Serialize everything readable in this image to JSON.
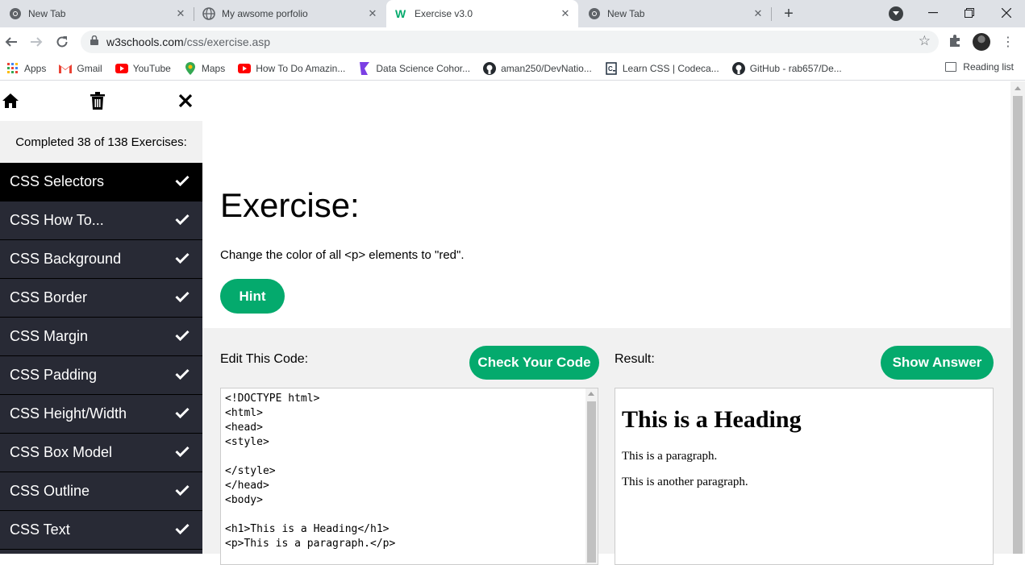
{
  "browser": {
    "tabs": [
      {
        "title": "New Tab",
        "icon": "chrome-icon",
        "active": false
      },
      {
        "title": "My awsome porfolio",
        "icon": "globe-icon",
        "active": false
      },
      {
        "title": "Exercise v3.0",
        "icon": "w3schools-icon",
        "active": true
      },
      {
        "title": "New Tab",
        "icon": "chrome-icon",
        "active": false
      }
    ],
    "close_glyph": "✕",
    "new_tab_glyph": "+",
    "url_domain": "w3schools.com",
    "url_path": "/css/exercise.asp",
    "bookmarks": [
      {
        "label": "Apps",
        "icon": "apps-grid-icon"
      },
      {
        "label": "Gmail",
        "icon": "gmail-icon"
      },
      {
        "label": "YouTube",
        "icon": "youtube-icon"
      },
      {
        "label": "Maps",
        "icon": "maps-icon"
      },
      {
        "label": "How To Do Amazin...",
        "icon": "youtube-icon"
      },
      {
        "label": "Data Science Cohor...",
        "icon": "data-science-icon"
      },
      {
        "label": "aman250/DevNatio...",
        "icon": "github-icon"
      },
      {
        "label": "Learn CSS | Codeca...",
        "icon": "codecademy-icon"
      },
      {
        "label": "GitHub - rab657/De...",
        "icon": "github-icon"
      }
    ],
    "reading_list": "Reading list"
  },
  "sidebar": {
    "completed_text": "Completed 38 of 138 Exercises:",
    "items": [
      {
        "label": "CSS Selectors",
        "done": true
      },
      {
        "label": "CSS How To...",
        "done": true
      },
      {
        "label": "CSS Background",
        "done": true
      },
      {
        "label": "CSS Border",
        "done": true
      },
      {
        "label": "CSS Margin",
        "done": true
      },
      {
        "label": "CSS Padding",
        "done": true
      },
      {
        "label": "CSS Height/Width",
        "done": true
      },
      {
        "label": "CSS Box Model",
        "done": true
      },
      {
        "label": "CSS Outline",
        "done": true
      },
      {
        "label": "CSS Text",
        "done": true
      }
    ]
  },
  "exercise": {
    "title": "Exercise:",
    "instruction": "Change the color of all <p> elements to \"red\".",
    "hint_label": "Hint",
    "edit_label": "Edit This Code:",
    "check_label": "Check Your Code",
    "result_label": "Result:",
    "answer_label": "Show Answer",
    "code": "<!DOCTYPE html>\n<html>\n<head>\n<style>\n\n</style>\n</head>\n<body>\n\n<h1>This is a Heading</h1>\n<p>This is a paragraph.</p>",
    "result": {
      "heading": "This is a Heading",
      "paragraphs": [
        "This is a paragraph.",
        "This is another paragraph."
      ]
    }
  },
  "colors": {
    "accent_green": "#04aa6d",
    "sidebar_bg": "#282a35",
    "sidebar_active": "#000000"
  }
}
